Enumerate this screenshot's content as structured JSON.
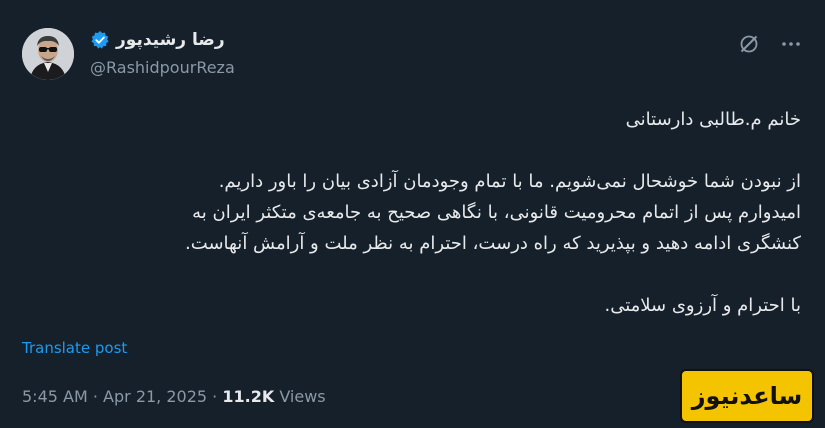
{
  "author": {
    "display_name": "رضا رشیدپور",
    "handle": "@RashidpourReza",
    "verified": true,
    "verified_color": "#1d9bf0"
  },
  "actions": {
    "grok_icon": "slash-circle-icon",
    "more_icon": "more-dots-icon"
  },
  "tweet": {
    "lines": [
      "خانم م.طالبی دارستانی",
      "",
      "از نبودن شما خوشحال نمی‌شویم. ما با تمام وجودمان آزادی بیان را باور داریم.",
      "امیدوارم پس از اتمام محرومیت قانونی، با نگاهی صحیح به جامعه‌ی متکثر ایران به",
      "کنشگری ادامه دهید و بپذیرید که راه درست، احترام به نظر ملت و آرامش آنهاست.",
      "",
      "با احترام و آرزوی سلامتی."
    ]
  },
  "translate_label": "Translate post",
  "meta": {
    "time": "5:45 AM",
    "separator": "·",
    "date": "Apr 21, 2025",
    "views_count": "11.2K",
    "views_label": "Views"
  },
  "watermark": {
    "text": "ساعدنیوز",
    "background": "#f5c400"
  }
}
